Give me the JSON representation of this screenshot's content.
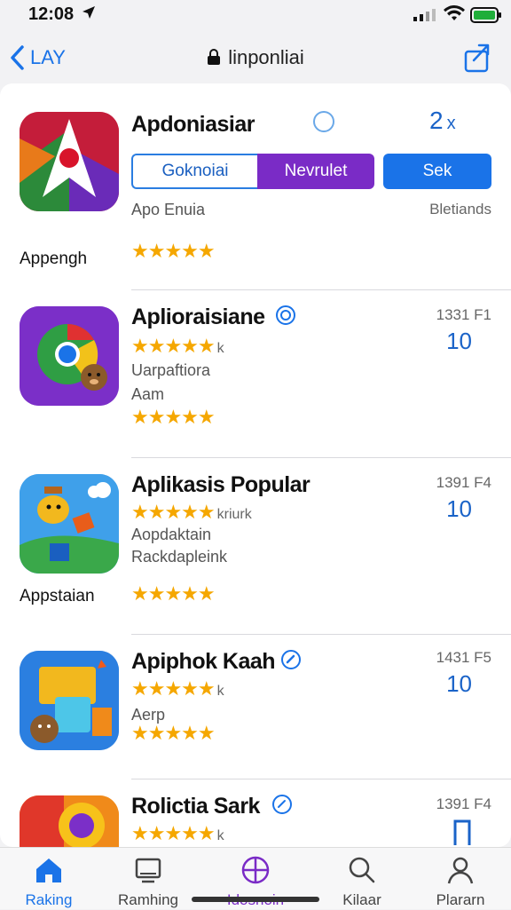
{
  "status": {
    "time": "12:08"
  },
  "nav": {
    "back_label": "LAY",
    "title": "linponliai"
  },
  "featured": {
    "name": "Apdoniasiar",
    "count": "2",
    "count_suffix": "x",
    "segment_left": "Goknoiai",
    "segment_right": "Nevrulet",
    "button": "Sek",
    "sub_left": "Apo Enuia",
    "sub_right": "Bletiands",
    "caption": "Appengh",
    "stars": "★★★★★"
  },
  "apps": [
    {
      "name": "Aplioraisiane",
      "stars": "★★★★★",
      "stars_extra": "k",
      "line1": "Uarpaftiora",
      "line2": "Aam",
      "stars2": "★★★★★",
      "info": "1331 F1",
      "count": "10",
      "caption": ""
    },
    {
      "name": "Aplikasis Popular",
      "stars": "★★★★★",
      "stars_extra": "kriurk",
      "line1": "Aopdaktain",
      "line2": "Rackdapleink",
      "stars2": "★★★★★",
      "info": "1391 F4",
      "count": "10",
      "caption": "Appstaian"
    },
    {
      "name": "Apiphok Kaah",
      "stars": "★★★★★",
      "stars_extra": "k",
      "line1": "Aerp",
      "line2": "",
      "stars2": "★★★★★",
      "info": "1431 F5",
      "count": "10",
      "caption": ""
    },
    {
      "name": "Rolictia Sark",
      "stars": "★★★★★",
      "stars_extra": "k",
      "line1": "",
      "line2": "",
      "stars2": "",
      "info": "1391 F4",
      "count": "",
      "caption": ""
    }
  ],
  "tabs": [
    {
      "label": "Raking",
      "icon": "home-icon",
      "active": true
    },
    {
      "label": "Ramhing",
      "icon": "tv-icon",
      "active": false
    },
    {
      "label": "Idosnoin",
      "icon": "grid-circle-icon",
      "active": false
    },
    {
      "label": "Kilaar",
      "icon": "search-icon",
      "active": false
    },
    {
      "label": "Plararn",
      "icon": "person-icon",
      "active": false
    }
  ],
  "colors": {
    "accent": "#1a73e8",
    "purple": "#7a2bc6",
    "star": "#f5a700"
  }
}
